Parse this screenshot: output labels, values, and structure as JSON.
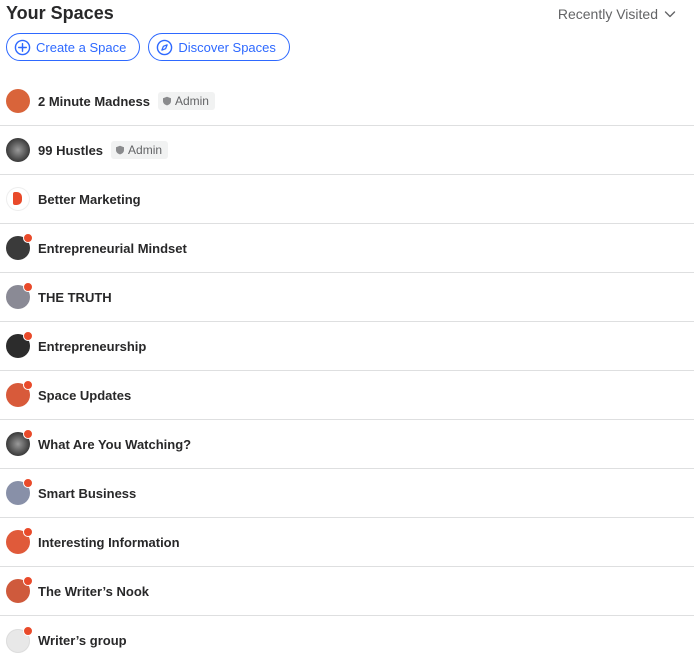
{
  "header": {
    "title": "Your Spaces",
    "sort_label": "Recently Visited"
  },
  "actions": {
    "create_label": "Create a Space",
    "discover_label": "Discover Spaces"
  },
  "colors": {
    "accent": "#2e69ff",
    "notification_dot": "#e94a2a"
  },
  "spaces": [
    {
      "name": "2 Minute Madness",
      "badge": "Admin",
      "avatar_color": "#d9643a"
    },
    {
      "name": "99 Hustles",
      "badge": "Admin",
      "avatar_color": "#5a5a5a"
    },
    {
      "name": "Better Marketing",
      "avatar_color": "#e07048"
    },
    {
      "name": "Entrepreneurial Mindset",
      "avatar_color": "#3a3a3a"
    },
    {
      "name": "THE TRUTH",
      "avatar_color": "#8a8a95"
    },
    {
      "name": "Entrepreneurship",
      "avatar_color": "#2c2c2c"
    },
    {
      "name": "Space Updates",
      "avatar_color": "#d85a3a"
    },
    {
      "name": "What Are You Watching?",
      "avatar_color": "#4a4a4a"
    },
    {
      "name": "Smart Business",
      "avatar_color": "#8890a8"
    },
    {
      "name": "Interesting Information",
      "avatar_color": "#e05a3a"
    },
    {
      "name": "The Writer’s Nook",
      "avatar_color": "#cf5a3c"
    },
    {
      "name": "Writer’s group",
      "avatar_color": "#e8e8e8"
    }
  ]
}
